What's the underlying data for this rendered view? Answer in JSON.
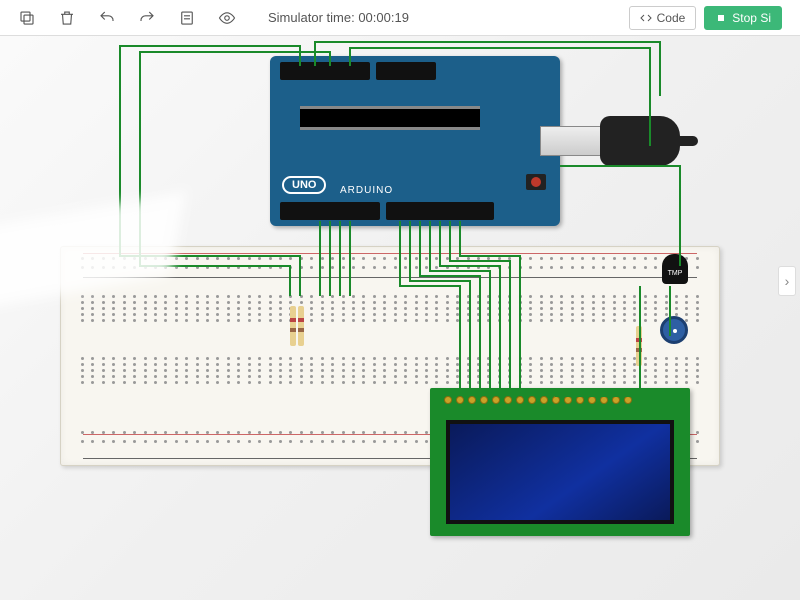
{
  "toolbar": {
    "simulator_time_label": "Simulator time:",
    "simulator_time_value": "00:00:19",
    "code_label": "Code",
    "stop_label": "Stop Si"
  },
  "arduino": {
    "model_label": "UNO",
    "brand_label": "ARDUINO"
  },
  "components": {
    "tmp_label": "TMP"
  },
  "breadboard": {
    "columns": 60
  },
  "lcd": {
    "pin_count": 16
  }
}
